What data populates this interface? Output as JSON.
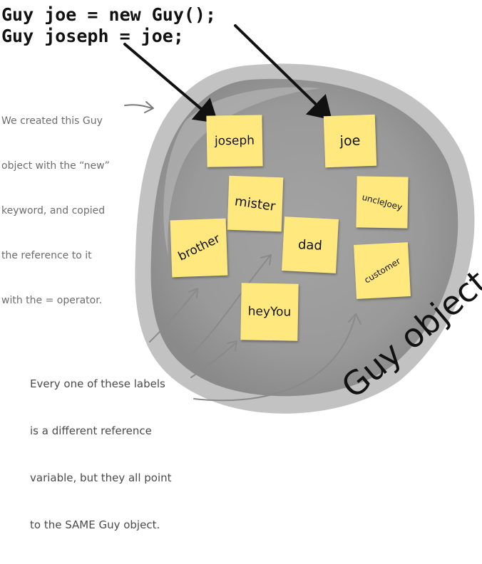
{
  "code_lines": [
    "Guy joe = new Guy();",
    "Guy joseph = joe;"
  ],
  "note_top": [
    "We created this Guy",
    "object with the “new”",
    "keyword, and copied",
    "the reference to it",
    "with the = operator."
  ],
  "note_bottom": [
    "Every one of these labels",
    "is a different reference",
    "variable, but they all point",
    "to the SAME Guy object."
  ],
  "object_label": "Guy object",
  "labels": {
    "joseph": "joseph",
    "joe": "joe",
    "mister": "mister",
    "uncleJoey": "uncleJoey",
    "brother": "brother",
    "dad": "dad",
    "customer": "customer",
    "heyYou": "heyYou"
  },
  "colors": {
    "sticky": "#ffe97f",
    "object": "#9e9e9e",
    "rim": "#bdbdbd",
    "arrow": "#111111",
    "hand_arrow": "#8a8a8a"
  }
}
